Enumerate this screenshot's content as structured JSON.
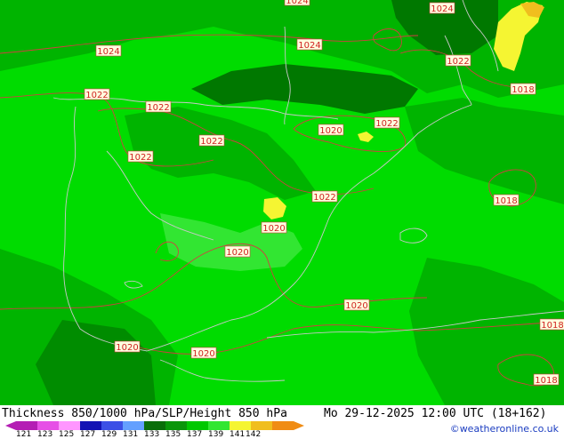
{
  "map": {
    "colors": {
      "bright_green": "#00dc00",
      "mid_green": "#00b400",
      "dark_green": "#008c00",
      "deep_green": "#007800",
      "light_green": "#32e632",
      "yellow": "#f5f532",
      "yellow_orange": "#f0be1e",
      "isobar": "#d04040",
      "coast": "#c8c8c8"
    },
    "isobar_labels": [
      {
        "id": "1024-top",
        "text": "1024"
      },
      {
        "id": "1024-ne",
        "text": "1024"
      },
      {
        "id": "1024-w",
        "text": "1024"
      },
      {
        "id": "1024-c",
        "text": "1024"
      },
      {
        "id": "1022-ne",
        "text": "1022"
      },
      {
        "id": "1018-ne",
        "text": "1018"
      },
      {
        "id": "1022-w",
        "text": "1022"
      },
      {
        "id": "1022-nw",
        "text": "1022"
      },
      {
        "id": "1020-n",
        "text": "1020"
      },
      {
        "id": "1022-n",
        "text": "1022"
      },
      {
        "id": "1022-c",
        "text": "1022"
      },
      {
        "id": "1022-sw",
        "text": "1022"
      },
      {
        "id": "1022-e",
        "text": "1022"
      },
      {
        "id": "1018-e",
        "text": "1018"
      },
      {
        "id": "1020-c",
        "text": "1020"
      },
      {
        "id": "1020-s",
        "text": "1020"
      },
      {
        "id": "1020-se",
        "text": "1020"
      },
      {
        "id": "1018-se",
        "text": "1018"
      },
      {
        "id": "1020-sw",
        "text": "1020"
      },
      {
        "id": "1020-ssw",
        "text": "1020"
      },
      {
        "id": "1018-sse",
        "text": "1018"
      }
    ]
  },
  "footer": {
    "title": "Thickness 850/1000 hPa/SLP/Height 850 hPa",
    "datetime": "Mo 29-12-2025 12:00 UTC (18+162)",
    "credit": "©weatheronline.co.uk",
    "scale_ticks": [
      "121",
      "123",
      "125",
      "127",
      "129",
      "131",
      "133",
      "135",
      "137",
      "139",
      "141",
      "142"
    ],
    "scale_colors": [
      "#b41eb4",
      "#e650e6",
      "#ff96ff",
      "#1414b4",
      "#3c50e6",
      "#64a0ff",
      "#0a6e0a",
      "#0a960a",
      "#00c800",
      "#32e632",
      "#f5f532",
      "#f0be1e",
      "#f08c14"
    ]
  }
}
